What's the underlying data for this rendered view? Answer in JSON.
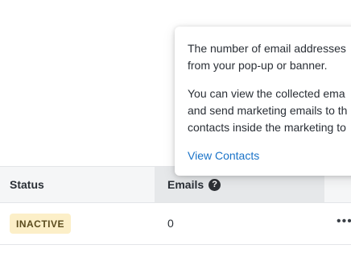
{
  "table": {
    "headers": {
      "status": "Status",
      "emails": "Emails"
    },
    "help_icon_glyph": "?",
    "rows": [
      {
        "status": "INACTIVE",
        "emails": "0",
        "more_glyph": "•••"
      }
    ]
  },
  "popover": {
    "paragraph1_lines": [
      "The number of email addresses",
      "from your pop-up or banner."
    ],
    "paragraph2_lines": [
      "You can view the collected ema",
      "and send marketing emails to th",
      "contacts inside the marketing to"
    ],
    "link": "View Contacts"
  },
  "colors": {
    "link": "#1a73c8",
    "badge_bg": "#fcefc8",
    "header_bg": "#f5f6f7",
    "sorted_header_bg": "#e6e8ea"
  }
}
